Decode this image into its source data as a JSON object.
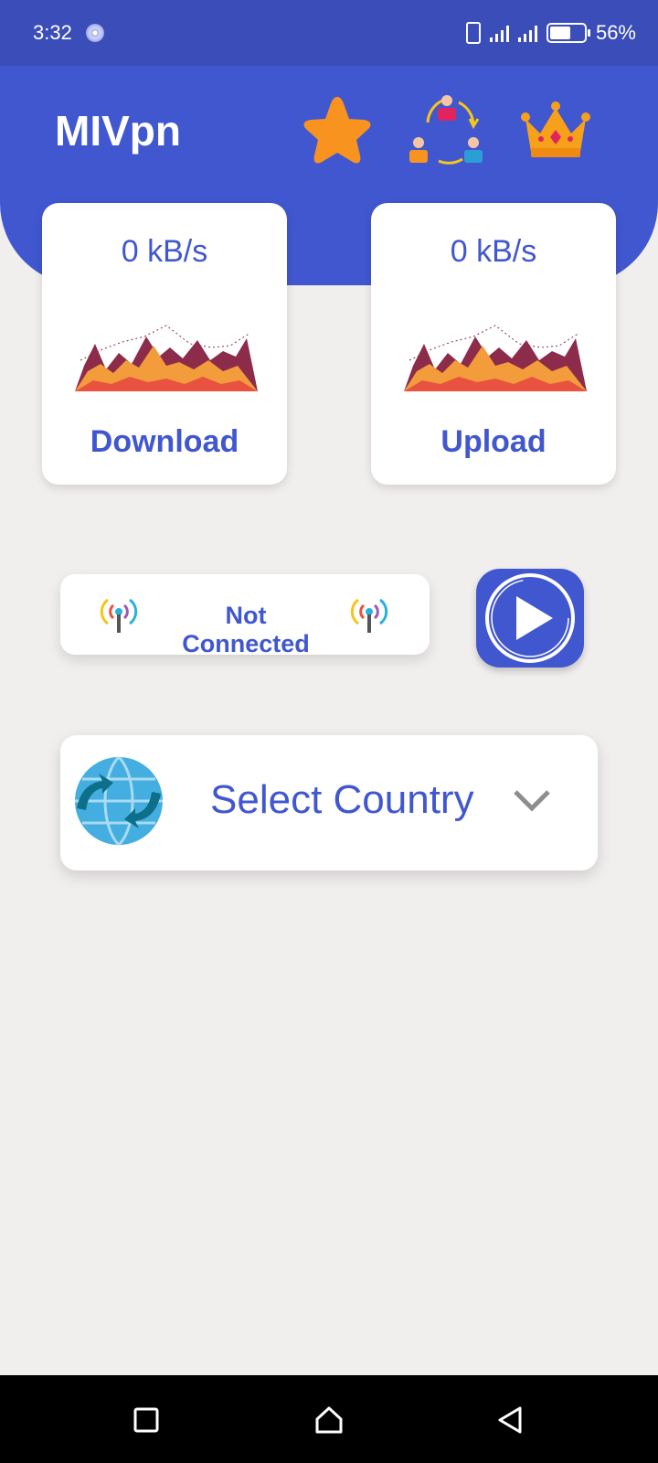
{
  "status_bar": {
    "time": "3:32",
    "battery": "56%"
  },
  "header": {
    "title": "MIVpn",
    "icons": [
      "star-icon",
      "share-people-icon",
      "crown-icon"
    ]
  },
  "stats": {
    "download": {
      "speed": "0 kB/s",
      "label": "Download"
    },
    "upload": {
      "speed": "0 kB/s",
      "label": "Upload"
    }
  },
  "connection": {
    "status": "Not Connected"
  },
  "country": {
    "placeholder": "Select Country"
  },
  "colors": {
    "primary": "#4157cf",
    "status_bar": "#3a4db8",
    "background": "#f1eeee",
    "star": "#f7931e",
    "crown": "#f7a11a"
  }
}
